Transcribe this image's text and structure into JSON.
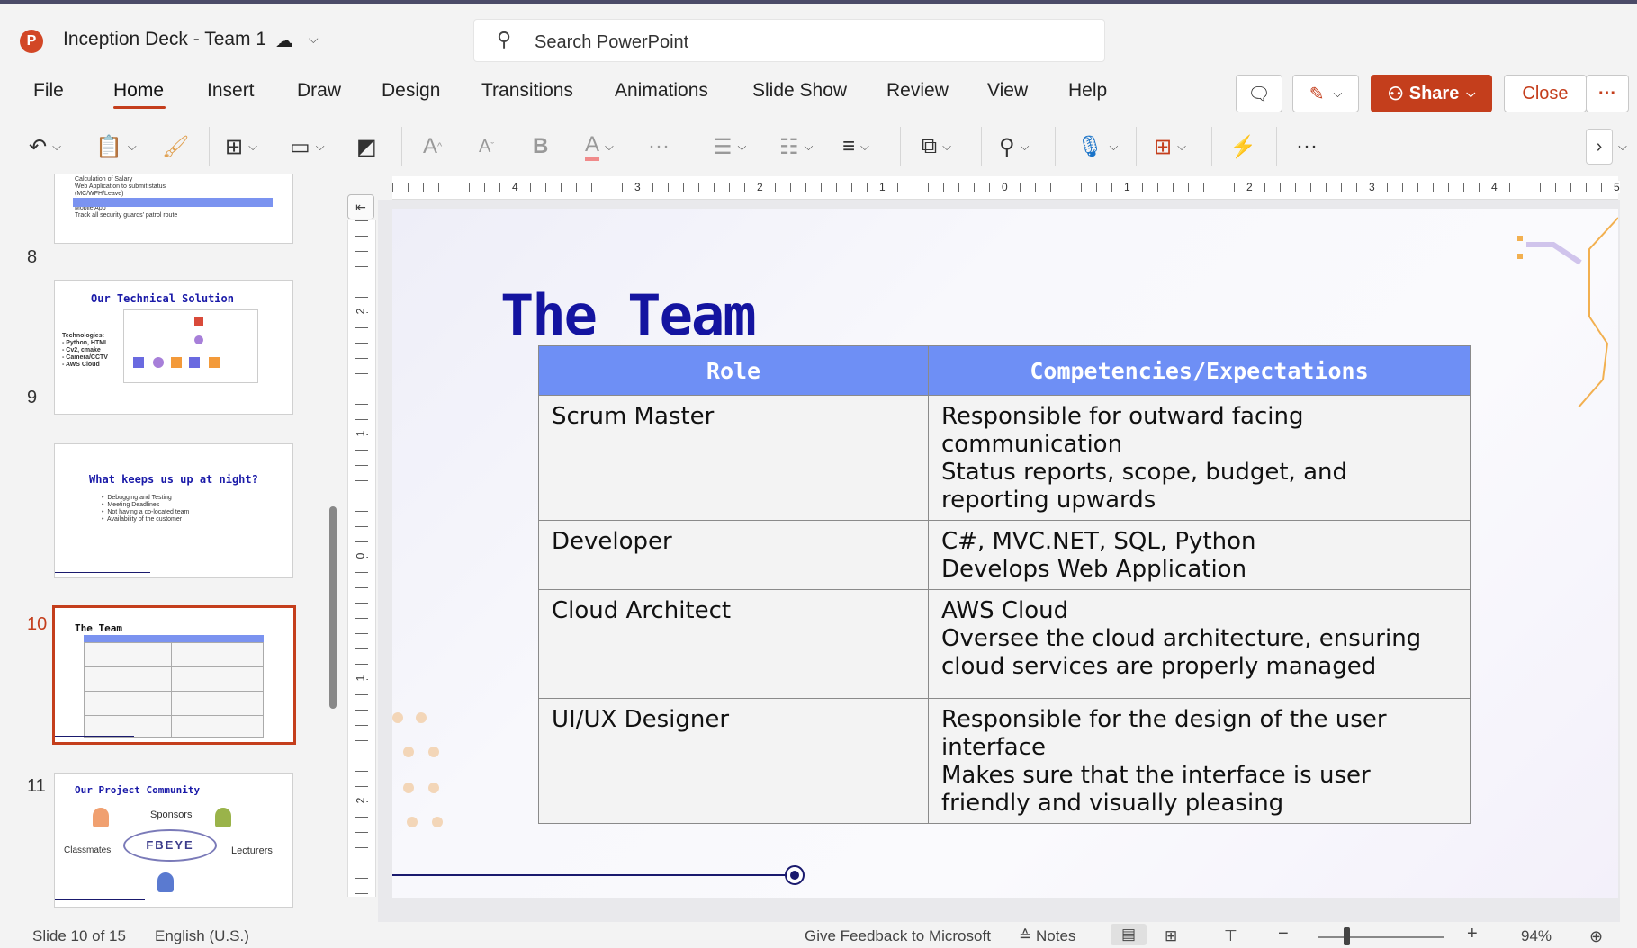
{
  "app": {
    "title": "Inception Deck - Team 1",
    "search_placeholder": "Search PowerPoint",
    "logo_letter": "P"
  },
  "menu": {
    "tabs": [
      "File",
      "Home",
      "Insert",
      "Draw",
      "Design",
      "Transitions",
      "Animations",
      "Slide Show",
      "Review",
      "View",
      "Help"
    ],
    "active_tab": "Home",
    "share_label": "Share",
    "close_label": "Close",
    "more_label": "···"
  },
  "ribbon": {
    "font_glyph": "A",
    "bold_glyph": "B"
  },
  "thumbnails": [
    {
      "number": "8",
      "title": "Our Technical Solution",
      "lines": "Technologies:\n- Python, HTML\n- Cv2, cmake\n- Camera/CCTV\n- AWS Cloud"
    },
    {
      "number": "9",
      "title": "What keeps us up at night?",
      "lines": "•  Debugging and Testing\n•  Meeting Deadlines\n•  Not having a co-located team\n•  Availability of the customer"
    },
    {
      "number": "10",
      "title": "The Team",
      "lines": ""
    },
    {
      "number": "11",
      "title": "Our Project Community",
      "sponsors": "Sponsors",
      "classmates": "Classmates",
      "lecturers": "Lecturers",
      "logo": "FBEYE"
    }
  ],
  "thumb_prev": {
    "lines": "Calculation of Salary\nWeb Application to submit status\n(MC/WFH/Leave)\n\nMobile App\nTrack all security guards' patrol route"
  },
  "ruler": {
    "h_labels": [
      "4",
      "3",
      "2",
      "1",
      "0",
      "1",
      "2",
      "3",
      "4",
      "5"
    ],
    "v_labels": [
      "2",
      "1",
      "0",
      "1",
      "2"
    ]
  },
  "slide": {
    "title": "The Team",
    "table": {
      "headers": [
        "Role",
        "Competencies/Expectations"
      ],
      "rows": [
        {
          "role": "Scrum Master",
          "competencies": "Responsible for outward facing communication\nStatus reports, scope, budget, and reporting upwards"
        },
        {
          "role": "Developer",
          "competencies": "C#, MVC.NET, SQL, Python\nDevelops Web Application"
        },
        {
          "role": "Cloud Architect",
          "competencies": "AWS Cloud\nOversee the cloud architecture, ensuring cloud services are properly managed"
        },
        {
          "role": "UI/UX Designer",
          "competencies": "Responsible for the design of the user interface\nMakes sure that the interface is user friendly and visually pleasing"
        }
      ]
    }
  },
  "status": {
    "slide_position": "Slide 10 of 15",
    "language": "English (U.S.)",
    "feedback": "Give Feedback to Microsoft",
    "notes": "Notes",
    "zoom": "94%",
    "zoom_level": 0.94
  },
  "colors": {
    "accent": "#c43e1c",
    "header_blue": "#6e8ff5",
    "title_navy": "#1414a0"
  }
}
